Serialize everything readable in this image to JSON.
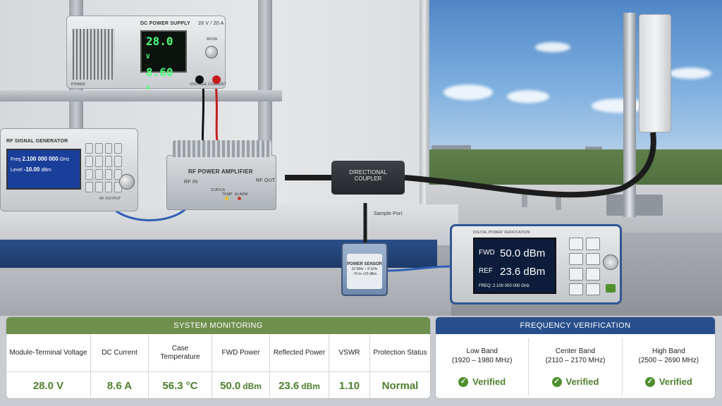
{
  "scene": {
    "psu": {
      "title": "DC POWER SUPPLY",
      "rating": "28 V / 20 A",
      "voltage_display": "28.0",
      "voltage_unit": "V",
      "current_display": "8.60",
      "current_unit": "A",
      "power_label": "POWER",
      "voltage_label": "VOLTAGE",
      "current_label": "CURRENT",
      "mode_label": "MODE"
    },
    "siggen": {
      "title": "RF SIGNAL GENERATOR",
      "freq_label": "Freq",
      "freq_value": "2.100 000 000",
      "freq_unit": "GHz",
      "level_label": "Level",
      "level_value": "-10.00",
      "level_unit": "dBm",
      "rf_output": "RF OUTPUT"
    },
    "amplifier": {
      "title": "RF POWER AMPLIFIER",
      "rf_in": "RF IN",
      "rf_out": "RF OUT",
      "status": "STATUS",
      "temp": "TEMP",
      "alarm": "ALARM"
    },
    "coupler": {
      "line1": "DIRECTIONAL",
      "line2": "COUPLER",
      "sample_port": "Sample Port"
    },
    "sensor": {
      "title": "POWER SENSOR",
      "spec1": "10 MHz – 8 GHz",
      "spec2": "-70 to +20 dBm"
    },
    "power_meter": {
      "title": "DIGITAL POWER VERIFICATION",
      "fwd_label": "FWD",
      "fwd_value": "50.0 dBm",
      "ref_label": "REF",
      "ref_value": "23.6 dBm",
      "freq_readout": "FREQ: 2.100 000 000 GHz"
    }
  },
  "system_monitoring": {
    "title": "SYSTEM MONITORING",
    "columns": [
      {
        "label": "Module-Terminal Voltage",
        "value": "28.0 V",
        "unit": ""
      },
      {
        "label": "DC Current",
        "value": "8.6 A",
        "unit": ""
      },
      {
        "label": "Case Temperature",
        "value": "56.3 °C",
        "unit": ""
      },
      {
        "label": "FWD Power",
        "value": "50.0",
        "unit": "dBm"
      },
      {
        "label": "Reflected Power",
        "value": "23.6",
        "unit": "dBm"
      },
      {
        "label": "VSWR",
        "value": "1.10",
        "unit": ""
      },
      {
        "label": "Protection Status",
        "value": "Normal",
        "unit": ""
      }
    ]
  },
  "frequency_verification": {
    "title": "FREQUENCY VERIFICATION",
    "bands": [
      {
        "name": "Low Band",
        "range": "(1920 – 1980 MHz)",
        "status": "Verified"
      },
      {
        "name": "Center Band",
        "range": "(2110 – 2170 MHz)",
        "status": "Verified"
      },
      {
        "name": "High Band",
        "range": "(2500 – 2690 MHz)",
        "status": "Verified"
      }
    ]
  },
  "colors": {
    "monitor_header": "#6f8f4d",
    "freq_header": "#284f8b",
    "value_green": "#4f7f2e"
  },
  "icons": {
    "verified": "check-circle-icon"
  }
}
